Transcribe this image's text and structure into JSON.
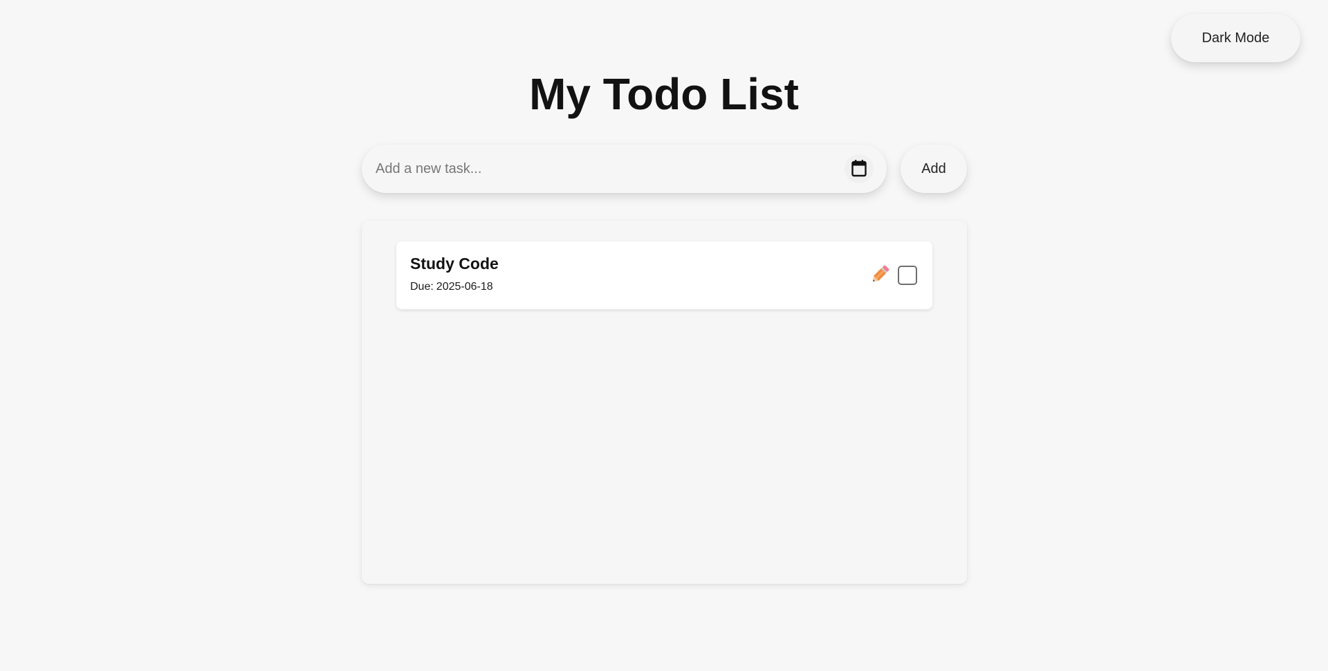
{
  "header": {
    "dark_mode_label": "Dark Mode"
  },
  "page_title": "My Todo List",
  "composer": {
    "placeholder": "Add a new task...",
    "value": "",
    "date_icon": "calendar-icon",
    "add_label": "Add"
  },
  "todos": [
    {
      "title": "Study Code",
      "due_label": "Due:",
      "due_date": "2025-06-18",
      "edit_icon": "pencil-icon",
      "completed": false
    }
  ],
  "colors": {
    "background": "#f7f7f7",
    "text": "#121212",
    "pencil_body": "#f08a3c",
    "pencil_eraser": "#f47c8e"
  }
}
